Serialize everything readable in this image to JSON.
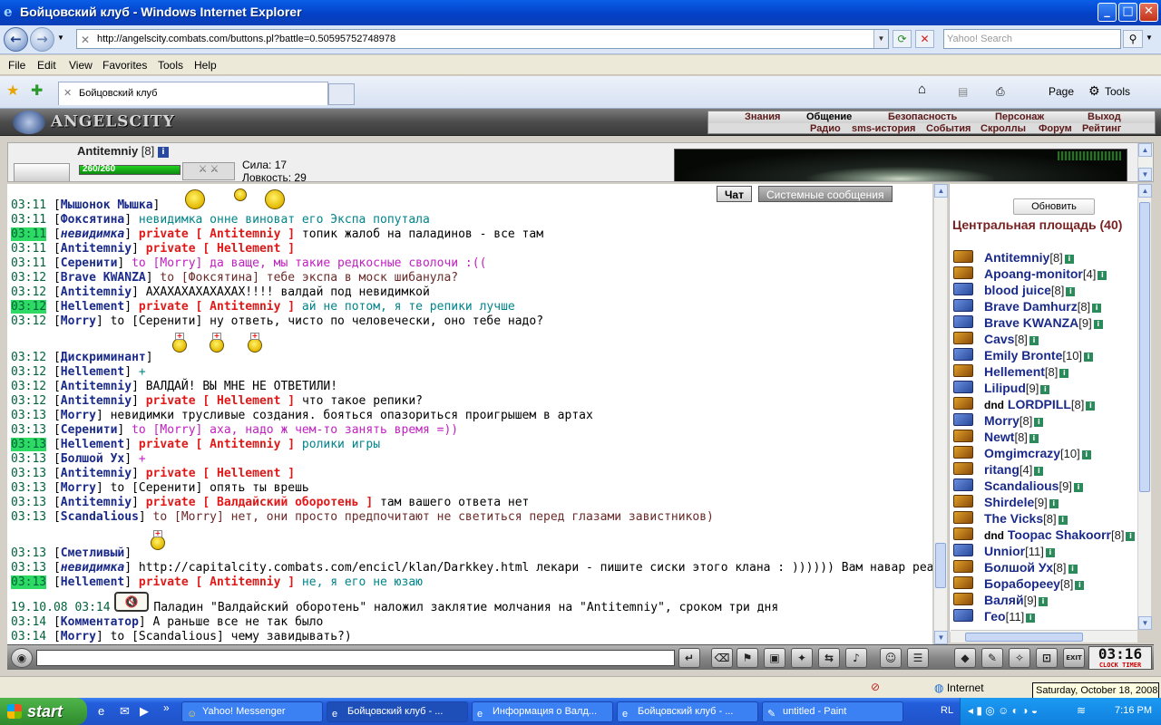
{
  "window": {
    "title": "Бойцовский клуб - Windows Internet Explorer",
    "minimize": "_",
    "maximize": "□",
    "close": "✕"
  },
  "browser": {
    "back": "←",
    "forward": "→",
    "url": "http://angelscity.combats.com/buttons.pl?battle=0.50595752748978",
    "search_placeholder": "Yahoo! Search",
    "menu": [
      "File",
      "Edit",
      "View",
      "Favorites",
      "Tools",
      "Help"
    ],
    "tab_title": "Бойцовский клуб",
    "commands": [
      "Page",
      "Tools"
    ]
  },
  "game": {
    "logo": "ANGELSCITY",
    "nav_top": [
      "Знания",
      "Общение",
      "Безопасность",
      "Персонаж",
      "Выход"
    ],
    "nav_bottom": [
      "Радио",
      "sms-история",
      "События",
      "Скроллы",
      "Форум",
      "Рейтинг"
    ],
    "character": {
      "name": "Antitemniy",
      "level": "[8]",
      "hp": "260/260",
      "hp_fraction": 1.0,
      "strength": "Сила: 17",
      "agility": "Ловкость: 29"
    },
    "chat_tabs": [
      "Чат",
      "Системные сообщения"
    ],
    "chat": [
      {
        "time": "03:11",
        "name": "Мышонок Мышка",
        "private": "",
        "text": "",
        "style": "tx"
      },
      {
        "time": "03:11",
        "name": "Фоксятина",
        "private": "",
        "text": "невидимка онне виноват его Экспа попутала",
        "style": "teal"
      },
      {
        "time": "03:11",
        "name": "невидимка",
        "private": "private [ Antitemniy ]",
        "text": "топик жалоб на паладинов - все там",
        "style": "tx"
      },
      {
        "time": "03:11",
        "name": "Antitemniy",
        "private": "private [ Hellement ]",
        "text": "",
        "style": "tx"
      },
      {
        "time": "03:11",
        "name": "Серенити",
        "private": "",
        "text": "to [Morry] да ваще, мы такие редкосные сволочи :((",
        "style": "mag"
      },
      {
        "time": "03:12",
        "name": "Brave KWANZA",
        "private": "",
        "text": "to [Фоксятина] тебе экспа в моск шибанула?",
        "style": "brown"
      },
      {
        "time": "03:12",
        "name": "Antitemniy",
        "private": "",
        "text": "АХАХАХАХАХАХАХ!!!! валдай под невидимкой",
        "style": "tx"
      },
      {
        "time": "03:12",
        "name": "Hellement",
        "private": "private [ Antitemniy ]",
        "text": "ай не потом, я те репики лучше",
        "style": "teal"
      },
      {
        "time": "03:12",
        "name": "Morry",
        "private": "",
        "text": "to [Серенити] ну ответь, чисто по человечески, оно тебе надо?",
        "style": "tx"
      },
      {
        "time": "03:12",
        "name": "Дискриминант",
        "private": "",
        "text": "",
        "style": "tx"
      },
      {
        "time": "03:12",
        "name": "Hellement",
        "private": "",
        "text": "+",
        "style": "teal"
      },
      {
        "time": "03:12",
        "name": "Antitemniy",
        "private": "",
        "text": "ВАЛДАЙ! ВЫ МНЕ НЕ ОТВЕТИЛИ!",
        "style": "tx"
      },
      {
        "time": "03:12",
        "name": "Antitemniy",
        "private": "private [ Hellement ]",
        "text": "что такое репики?",
        "style": "tx"
      },
      {
        "time": "03:13",
        "name": "Morry",
        "private": "",
        "text": "невидимки трусливые создания. бояться опазориться проигрышем в артах",
        "style": "tx"
      },
      {
        "time": "03:13",
        "name": "Серенити",
        "private": "",
        "text": "to [Morry] аха, надо ж чем-то занять время =))",
        "style": "mag"
      },
      {
        "time": "03:13",
        "name": "Hellement",
        "private": "private [ Antitemniy ]",
        "text": "ролики игры",
        "style": "teal"
      },
      {
        "time": "03:13",
        "name": "Болшой Ух",
        "private": "",
        "text": "+",
        "style": "mag"
      },
      {
        "time": "03:13",
        "name": "Antitemniy",
        "private": "private [ Hellement ]",
        "text": "",
        "style": "tx"
      },
      {
        "time": "03:13",
        "name": "Morry",
        "private": "",
        "text": "to [Серенити] опять ты врешь",
        "style": "tx"
      },
      {
        "time": "03:13",
        "name": "Antitemniy",
        "private": "private [ Валдайский оборотень ]",
        "text": "там вашего ответа нет",
        "style": "tx"
      },
      {
        "time": "03:13",
        "name": "Scandalious",
        "private": "",
        "text": "to [Morry] нет, они просто предпочитают не светиться перед глазами завистников)",
        "style": "brown"
      },
      {
        "time": "03:13",
        "name": "Сметливый",
        "private": "",
        "text": "",
        "style": "tx"
      },
      {
        "time": "03:13",
        "name": "невидимка",
        "private": "",
        "text": "http://capitalcity.combats.com/encicl/klan/Darkkey.html лекари - пишите сиски этого клана : )))))) Вам навар реальный)))",
        "style": "tx"
      },
      {
        "time": "03:13",
        "name": "Hellement",
        "private": "private [ Antitemniy ]",
        "text": "не, я его не юзаю",
        "style": "teal"
      },
      {
        "time": "19.10.08 03:14",
        "name": "",
        "private": "",
        "text": "Паладин \"Валдайский оборотень\" наложил заклятие молчания на \"Antitemniy\", сроком три дня",
        "style": "tx"
      },
      {
        "time": "03:14",
        "name": "Комментатор",
        "private": "",
        "text": "А раньше все не так было",
        "style": "tx"
      },
      {
        "time": "03:14",
        "name": "Morry",
        "private": "",
        "text": "to [Scandalious] чему завидывать?)",
        "style": "tx"
      }
    ],
    "room": {
      "refresh": "Обновить",
      "title": "Центральная площадь (40)",
      "users": [
        {
          "name": "Antitemniy",
          "level": "[8]",
          "prefix": ""
        },
        {
          "name": "Apoang-monitor",
          "level": "[4]",
          "prefix": ""
        },
        {
          "name": "blood juice",
          "level": "[8]",
          "prefix": ""
        },
        {
          "name": "Brave Damhurz",
          "level": "[8]",
          "prefix": ""
        },
        {
          "name": "Brave KWANZA",
          "level": "[9]",
          "prefix": ""
        },
        {
          "name": "Cavs",
          "level": "[8]",
          "prefix": ""
        },
        {
          "name": "Emily Bronte",
          "level": "[10]",
          "prefix": ""
        },
        {
          "name": "Hellement",
          "level": "[8]",
          "prefix": ""
        },
        {
          "name": "Lilipud",
          "level": "[9]",
          "prefix": ""
        },
        {
          "name": "LORDPILL",
          "level": "[8]",
          "prefix": "dnd"
        },
        {
          "name": "Morry",
          "level": "[8]",
          "prefix": ""
        },
        {
          "name": "Newt",
          "level": "[8]",
          "prefix": ""
        },
        {
          "name": "Omgimcrazy",
          "level": "[10]",
          "prefix": ""
        },
        {
          "name": "ritang",
          "level": "[4]",
          "prefix": ""
        },
        {
          "name": "Scandalious",
          "level": "[9]",
          "prefix": ""
        },
        {
          "name": "Shirdele",
          "level": "[9]",
          "prefix": ""
        },
        {
          "name": "The Vicks",
          "level": "[8]",
          "prefix": ""
        },
        {
          "name": "Toopac Shakoorr",
          "level": "[8]",
          "prefix": "dnd"
        },
        {
          "name": "Unnior",
          "level": "[11]",
          "prefix": ""
        },
        {
          "name": "Болшой Ух",
          "level": "[8]",
          "prefix": ""
        },
        {
          "name": "Бораборееу",
          "level": "[8]",
          "prefix": ""
        },
        {
          "name": "Валяй",
          "level": "[9]",
          "prefix": ""
        },
        {
          "name": "Гео",
          "level": "[11]",
          "prefix": ""
        }
      ]
    },
    "clock": "03:16",
    "clock_sub": "CLOCK  TIMER"
  },
  "status": {
    "zone": "Internet",
    "tooltip": "Saturday, October 18, 2008"
  },
  "taskbar": {
    "start": "start",
    "tasks": [
      "Yahoo! Messenger",
      "Бойцовский клуб - ...",
      "Информация о Валд...",
      "Бойцовский клуб - ...",
      "untitled - Paint"
    ],
    "lang": "RL",
    "time": "7:16 PM"
  }
}
